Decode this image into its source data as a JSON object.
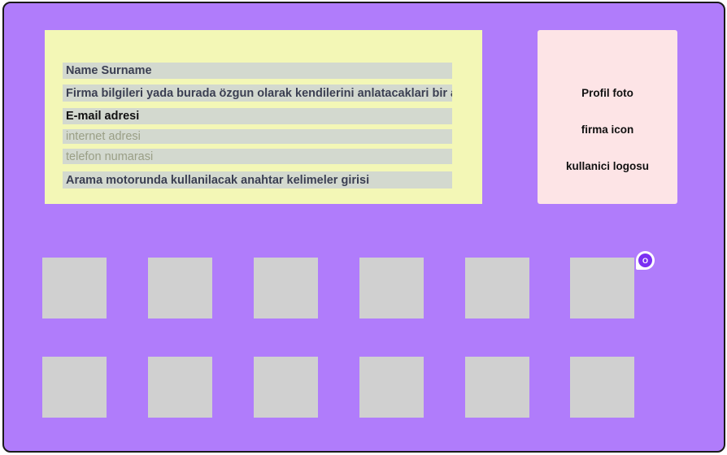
{
  "info_card": {
    "fields": [
      {
        "label": "Name Surname"
      },
      {
        "label": "Firma bilgileri yada burada özgun olarak kendilerini anlatacaklari bir alan"
      },
      {
        "label": "E-mail adresi"
      },
      {
        "label": "internet adresi"
      },
      {
        "label": "telefon numarasi"
      },
      {
        "label": "Arama motorunda kullanilacak anahtar kelimeler girisi"
      }
    ]
  },
  "profile_card": {
    "lines": [
      "Profil foto",
      "firma icon",
      "kullanici logosu"
    ]
  },
  "comment_badge": {
    "label": "O"
  },
  "colors": {
    "background": "#b07cfb",
    "info_card": "#f3f7b6",
    "profile_card": "#fde4e6",
    "tile": "#d0d0d0",
    "badge": "#7b2ff2"
  }
}
